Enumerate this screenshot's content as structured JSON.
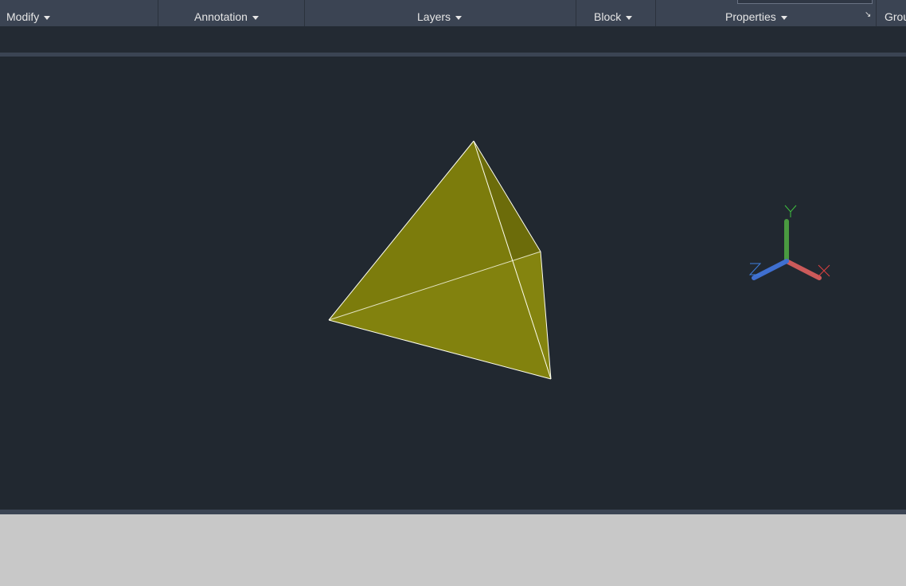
{
  "ribbon": {
    "panels": [
      {
        "label": "Modify"
      },
      {
        "label": "Annotation"
      },
      {
        "label": "Layers"
      },
      {
        "label": "Block"
      },
      {
        "label": "Properties"
      },
      {
        "label": "Grou"
      }
    ]
  },
  "ucs": {
    "x_label": "X",
    "y_label": "Y",
    "z_label": "Z"
  },
  "colors": {
    "solid": "#808010",
    "edge": "#ffffc0",
    "x_axis": "#d05050",
    "y_axis": "#4a9a40",
    "z_axis": "#3f6fd0"
  }
}
